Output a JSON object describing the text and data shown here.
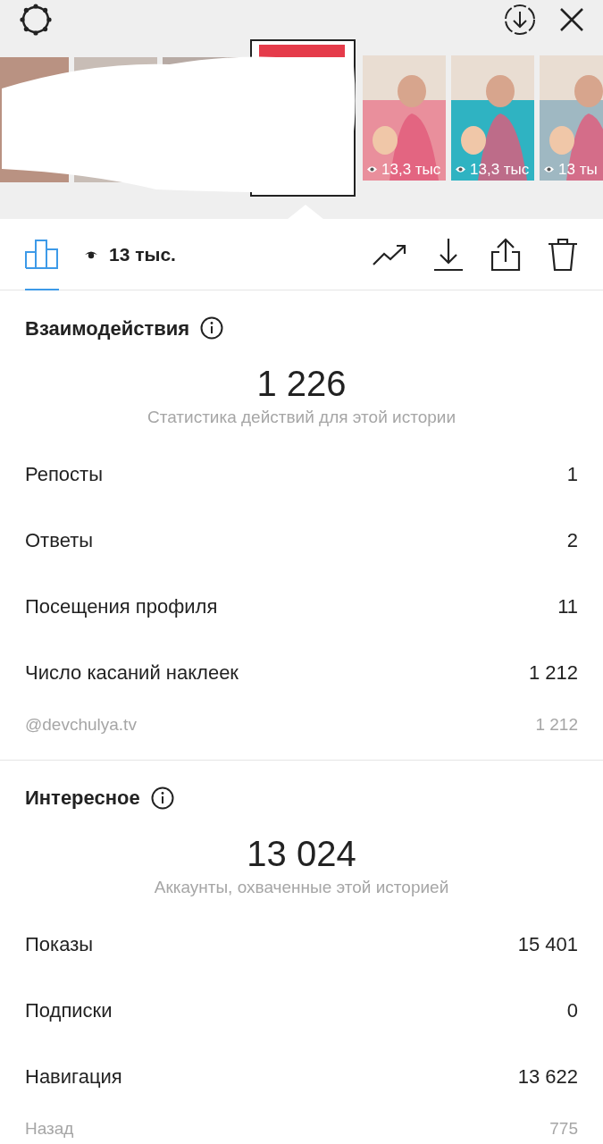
{
  "thumbnails": [
    {
      "views": "13,3 тыс"
    },
    {
      "views": "13,3 тыс"
    },
    {
      "views": "13 ты"
    }
  ],
  "insights_tab": {
    "selected": true
  },
  "views": "13 тыс.",
  "sections": [
    {
      "title": "Взаимодействия",
      "total": "1 226",
      "caption": "Статистика действий для этой истории",
      "rows": [
        {
          "kind": "main",
          "label": "Репосты",
          "value": "1"
        },
        {
          "kind": "main",
          "label": "Ответы",
          "value": "2"
        },
        {
          "kind": "main",
          "label": "Посещения профиля",
          "value": "11"
        },
        {
          "kind": "main",
          "label": "Число касаний наклеек",
          "value": "1 212"
        },
        {
          "kind": "sub",
          "label": "@devchulya.tv",
          "value": "1 212"
        }
      ]
    },
    {
      "title": "Интересное",
      "total": "13 024",
      "caption": "Аккаунты, охваченные этой историей",
      "rows": [
        {
          "kind": "main",
          "label": "Показы",
          "value": "15 401"
        },
        {
          "kind": "main",
          "label": "Подписки",
          "value": "0"
        },
        {
          "kind": "main",
          "label": "Навигация",
          "value": "13 622"
        },
        {
          "kind": "sub",
          "label": "Назад",
          "value": "775"
        }
      ]
    }
  ]
}
